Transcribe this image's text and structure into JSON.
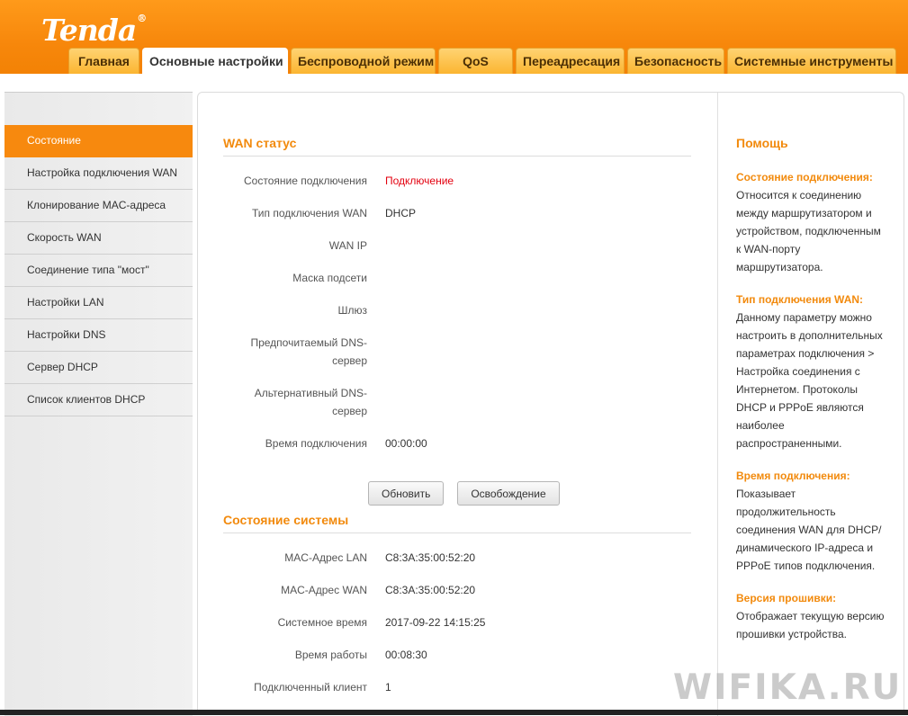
{
  "brand": {
    "logo": "Tenda",
    "reg": "®"
  },
  "nav": {
    "tabs": [
      {
        "label": "Главная"
      },
      {
        "label": "Основные настройки"
      },
      {
        "label": "Беспроводной режим"
      },
      {
        "label": "QoS"
      },
      {
        "label": "Переадресация"
      },
      {
        "label": "Безопасность"
      },
      {
        "label": "Системные инструменты"
      }
    ],
    "active_index": 1
  },
  "sidebar": {
    "items": [
      {
        "label": "Состояние"
      },
      {
        "label": "Настройка подключения WAN"
      },
      {
        "label": "Клонирование MAC-адреса"
      },
      {
        "label": "Скорость WAN"
      },
      {
        "label": "Соединение типа \"мост\""
      },
      {
        "label": "Настройки LAN"
      },
      {
        "label": "Настройки DNS"
      },
      {
        "label": "Сервер DHCP"
      },
      {
        "label": "Список клиентов DHCP"
      }
    ],
    "active_index": 0
  },
  "wan": {
    "title": "WAN статус",
    "rows": [
      {
        "label": "Состояние подключения",
        "value": "Подключение"
      },
      {
        "label": "Тип подключения WAN",
        "value": "DHCP"
      },
      {
        "label": "WAN IP",
        "value": ""
      },
      {
        "label": "Маска подсети",
        "value": ""
      },
      {
        "label": "Шлюз",
        "value": ""
      },
      {
        "label_line1": "Предпочитаемый DNS-",
        "label_line2": "сервер",
        "value": ""
      },
      {
        "label_line1": "Альтернативный DNS-",
        "label_line2": "сервер",
        "value": ""
      },
      {
        "label": "Время подключения",
        "value": "00:00:00"
      }
    ],
    "connection_status_color": "#e3000f",
    "buttons": {
      "refresh": "Обновить",
      "release": "Освобождение"
    }
  },
  "system": {
    "title": "Состояние системы",
    "rows": [
      {
        "label": "MAC-Адрес LAN",
        "value": "C8:3A:35:00:52:20"
      },
      {
        "label": "MAC-Адрес WAN",
        "value": "C8:3A:35:00:52:20"
      },
      {
        "label": "Системное время",
        "value": "2017-09-22 14:15:25"
      },
      {
        "label": "Время работы",
        "value": "00:08:30"
      },
      {
        "label": "Подключенный клиент",
        "value": "1"
      }
    ]
  },
  "help": {
    "title": "Помощь",
    "blocks": [
      {
        "heading": "Состояние подключения:",
        "lines": [
          "Относится к соединению",
          "между маршрутизатором и",
          "устройством, подключенным",
          "к WAN-порту",
          "маршрутизатора."
        ]
      },
      {
        "heading": "Тип подключения WAN:",
        "lines": [
          "Данному параметру можно",
          "настроить в дополнительных",
          "параметрах подключения >",
          "Настройка соединения с",
          "Интернетом. Протоколы",
          "DHCP и PPPoE являются",
          "наиболее",
          "распространенными."
        ]
      },
      {
        "heading": "Время подключения:",
        "lines": [
          "Показывает",
          "продолжительность",
          "соединения WAN для DHCP/",
          "динамического IP-адреса и",
          "PPPoE типов подключения."
        ]
      },
      {
        "heading": "Версия прошивки:",
        "lines": [
          "Отображает текущую версию",
          "прошивки устройства."
        ]
      }
    ]
  },
  "watermark": "WIFIKA.RU",
  "colors": {
    "accent": "#f7890e",
    "header": "#f7870b",
    "title": "#f28a0d"
  }
}
